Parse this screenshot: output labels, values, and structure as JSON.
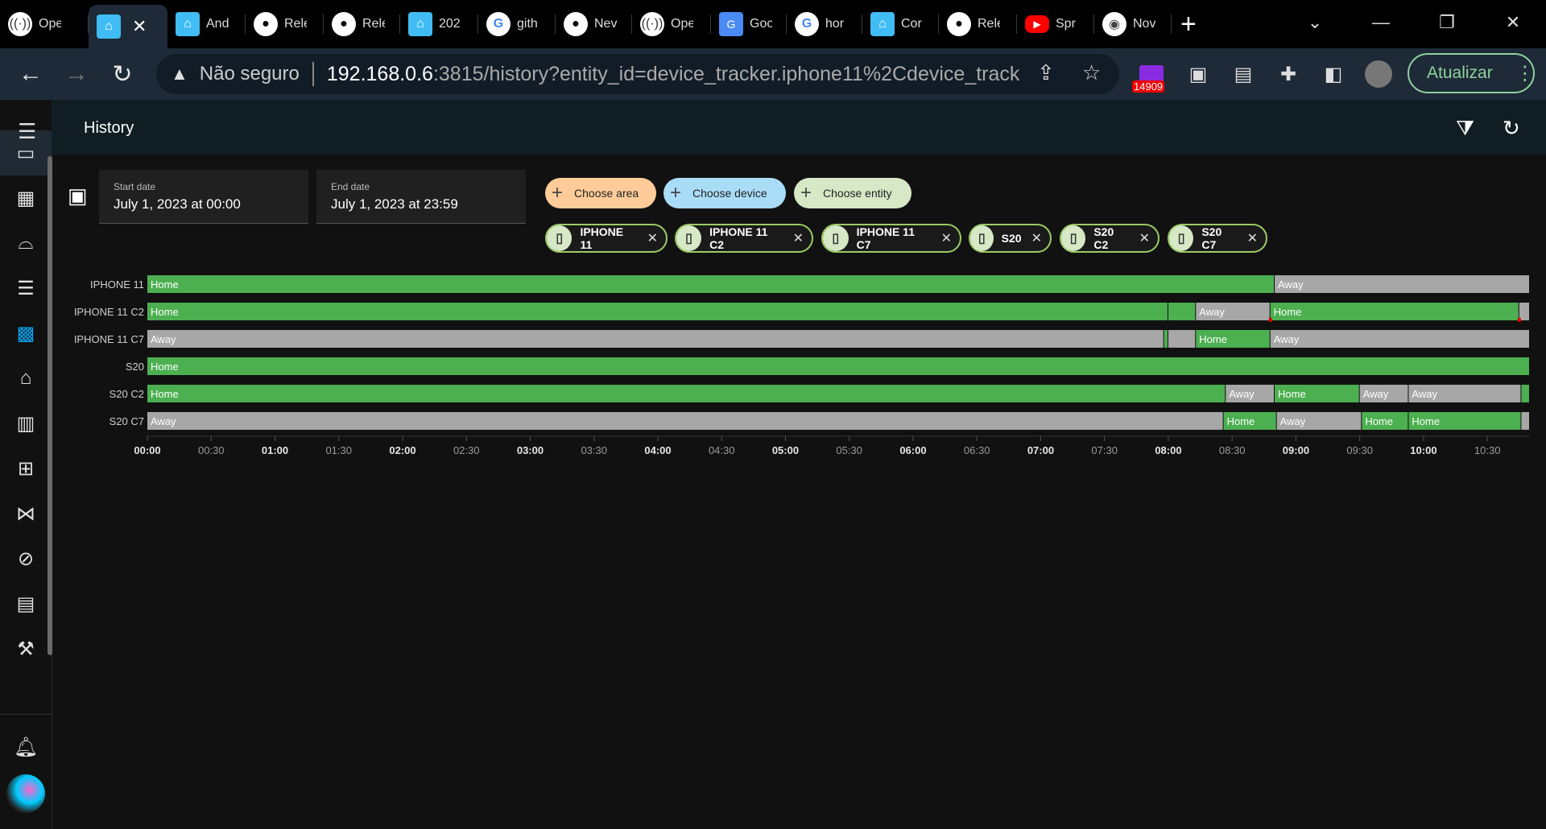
{
  "browser": {
    "tabs": [
      {
        "title": "Ope",
        "icon": "wifi-icon",
        "cls": "wifi",
        "glyph": "((·))"
      },
      {
        "title": "",
        "icon": "home-assistant-icon",
        "cls": "ha",
        "glyph": "⌂",
        "active": true
      },
      {
        "title": "And",
        "icon": "home-assistant-icon",
        "cls": "ha",
        "glyph": "⌂"
      },
      {
        "title": "Rele",
        "icon": "github-icon",
        "cls": "gh",
        "glyph": "●"
      },
      {
        "title": "Rele",
        "icon": "github-icon",
        "cls": "gh",
        "glyph": "●"
      },
      {
        "title": "202",
        "icon": "home-assistant-icon",
        "cls": "ha",
        "glyph": "⌂"
      },
      {
        "title": "gith",
        "icon": "google-icon",
        "cls": "g",
        "glyph": "G"
      },
      {
        "title": "Nev",
        "icon": "github-icon",
        "cls": "gh",
        "glyph": "●"
      },
      {
        "title": "Ope",
        "icon": "wifi-icon",
        "cls": "wifi",
        "glyph": "((·))"
      },
      {
        "title": "Goo",
        "icon": "google-translate-icon",
        "cls": "gt",
        "glyph": "G"
      },
      {
        "title": "hor",
        "icon": "google-icon",
        "cls": "g",
        "glyph": "G"
      },
      {
        "title": "Cor",
        "icon": "home-assistant-icon",
        "cls": "ha",
        "glyph": "⌂"
      },
      {
        "title": "Rele",
        "icon": "github-icon",
        "cls": "gh",
        "glyph": "●"
      },
      {
        "title": "Spr",
        "icon": "youtube-icon",
        "cls": "yt",
        "glyph": "▶"
      },
      {
        "title": "Nov",
        "icon": "chrome-icon",
        "cls": "ch",
        "glyph": "◉"
      }
    ],
    "new_tab": "+",
    "security_label": "Não seguro",
    "url_host": "192.168.0.6",
    "url_rest": ":3815/history?entity_id=device_tracker.iphone11%2Cdevice_track...",
    "extension_badge": "14909",
    "update_label": "Atualizar"
  },
  "app": {
    "page_title": "History",
    "start_date": {
      "label": "Start date",
      "value": "July 1, 2023 at 00:00"
    },
    "end_date": {
      "label": "End date",
      "value": "July 1, 2023 at 23:59"
    },
    "pickers": {
      "area": "Choose area",
      "device": "Choose device",
      "entity": "Choose entity"
    },
    "chips": [
      "IPHONE 11",
      "IPHONE 11 C2",
      "IPHONE 11 C7",
      "S20",
      "S20 C2",
      "S20 C7"
    ],
    "colors": {
      "home": "#4caf50",
      "away": "#a7a7a7",
      "unknown": "#e00000"
    }
  },
  "chart_data": {
    "type": "timeline",
    "x_ticks": [
      "00:00",
      "00:30",
      "01:00",
      "01:30",
      "02:00",
      "02:30",
      "03:00",
      "03:30",
      "04:00",
      "04:30",
      "05:00",
      "05:30",
      "06:00",
      "06:30",
      "07:00",
      "07:30",
      "08:00",
      "08:30",
      "09:00",
      "09:30",
      "10:00",
      "10:30"
    ],
    "x_range": [
      "00:00",
      "10:50"
    ],
    "rows": [
      {
        "name": "IPHONE 11",
        "segments": [
          {
            "start": "00:00",
            "end": "08:50",
            "state": "Home"
          },
          {
            "start": "08:50",
            "end": "10:50",
            "state": "Away"
          }
        ]
      },
      {
        "name": "IPHONE 11 C2",
        "segments": [
          {
            "start": "00:00",
            "end": "08:00",
            "state": "Home"
          },
          {
            "start": "08:00",
            "end": "08:13",
            "state": "Home"
          },
          {
            "start": "08:13",
            "end": "08:48",
            "state": "Away"
          },
          {
            "start": "08:48",
            "end": "10:45",
            "state": "Home"
          },
          {
            "start": "10:45",
            "end": "10:50",
            "state": "Away"
          }
        ]
      },
      {
        "name": "IPHONE 11 C7",
        "segments": [
          {
            "start": "00:00",
            "end": "07:58",
            "state": "Away"
          },
          {
            "start": "07:58",
            "end": "08:00",
            "state": "Home"
          },
          {
            "start": "08:00",
            "end": "08:13",
            "state": "Away"
          },
          {
            "start": "08:13",
            "end": "08:48",
            "state": "Home"
          },
          {
            "start": "08:48",
            "end": "10:50",
            "state": "Away"
          }
        ]
      },
      {
        "name": "S20",
        "segments": [
          {
            "start": "00:00",
            "end": "10:50",
            "state": "Home"
          }
        ]
      },
      {
        "name": "S20 C2",
        "segments": [
          {
            "start": "00:00",
            "end": "08:27",
            "state": "Home"
          },
          {
            "start": "08:27",
            "end": "08:50",
            "state": "Away"
          },
          {
            "start": "08:50",
            "end": "09:30",
            "state": "Home"
          },
          {
            "start": "09:30",
            "end": "09:53",
            "state": "Away"
          },
          {
            "start": "09:53",
            "end": "10:46",
            "state": "Away"
          },
          {
            "start": "10:46",
            "end": "10:50",
            "state": "Home"
          }
        ]
      },
      {
        "name": "S20 C7",
        "segments": [
          {
            "start": "00:00",
            "end": "08:26",
            "state": "Away"
          },
          {
            "start": "08:26",
            "end": "08:51",
            "state": "Home"
          },
          {
            "start": "08:51",
            "end": "09:31",
            "state": "Away"
          },
          {
            "start": "09:31",
            "end": "09:53",
            "state": "Home"
          },
          {
            "start": "09:53",
            "end": "10:46",
            "state": "Home"
          },
          {
            "start": "10:46",
            "end": "10:50",
            "state": "Away"
          }
        ]
      }
    ]
  }
}
